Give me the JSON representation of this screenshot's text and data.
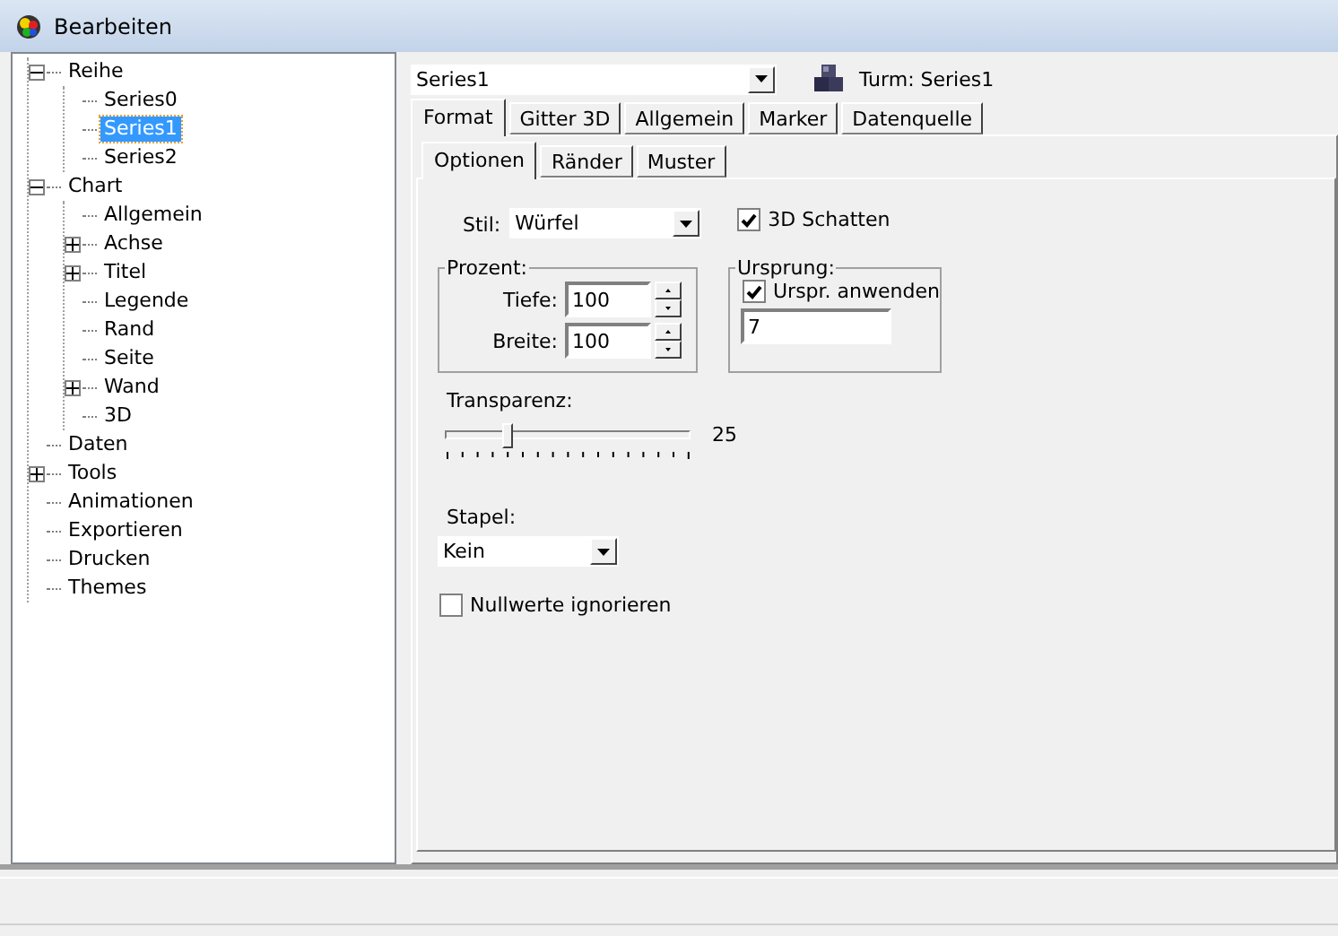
{
  "window": {
    "title": "Bearbeiten"
  },
  "tree": [
    {
      "label": "Reihe",
      "expanded": true,
      "selected": false,
      "children": [
        {
          "label": "Series0",
          "selected": false
        },
        {
          "label": "Series1",
          "selected": true
        },
        {
          "label": "Series2",
          "selected": false
        }
      ]
    },
    {
      "label": "Chart",
      "expanded": true,
      "selected": false,
      "children": [
        {
          "label": "Allgemein",
          "selected": false
        },
        {
          "label": "Achse",
          "expanded": false,
          "selected": false
        },
        {
          "label": "Titel",
          "expanded": false,
          "selected": false
        },
        {
          "label": "Legende",
          "selected": false
        },
        {
          "label": "Rand",
          "selected": false
        },
        {
          "label": "Seite",
          "selected": false
        },
        {
          "label": "Wand",
          "expanded": false,
          "selected": false
        },
        {
          "label": "3D",
          "selected": false
        }
      ]
    },
    {
      "label": "Daten",
      "selected": false
    },
    {
      "label": "Tools",
      "expanded": false,
      "selected": false
    },
    {
      "label": "Animationen",
      "selected": false
    },
    {
      "label": "Exportieren",
      "selected": false
    },
    {
      "label": "Drucken",
      "selected": false
    },
    {
      "label": "Themes",
      "selected": false
    }
  ],
  "series_select": {
    "value": "Series1"
  },
  "series_type": "Turm: Series1",
  "tabs": [
    {
      "label": "Format",
      "selected": true
    },
    {
      "label": "Gitter 3D",
      "selected": false
    },
    {
      "label": "Allgemein",
      "selected": false
    },
    {
      "label": "Marker",
      "selected": false
    },
    {
      "label": "Datenquelle",
      "selected": false
    }
  ],
  "subtabs": [
    {
      "label": "Optionen",
      "selected": true
    },
    {
      "label": "Ränder",
      "selected": false
    },
    {
      "label": "Muster",
      "selected": false
    }
  ],
  "style": {
    "label": "Stil:",
    "value": "Würfel"
  },
  "shadow_3d": {
    "label": "3D Schatten",
    "checked": true
  },
  "percent": {
    "title": "Prozent:",
    "depth": {
      "label": "Tiefe:",
      "value": "100"
    },
    "width": {
      "label": "Breite:",
      "value": "100"
    }
  },
  "origin": {
    "title": "Ursprung:",
    "apply": {
      "label": "Urspr. anwenden",
      "checked": true
    },
    "value": "7"
  },
  "transparency": {
    "label": "Transparenz:",
    "level": 0.25,
    "reading": "25"
  },
  "stack": {
    "label": "Stapel:",
    "value": "Kein"
  },
  "ignore_nulls": {
    "label": "Nullwerte ignorieren",
    "checked": false
  }
}
